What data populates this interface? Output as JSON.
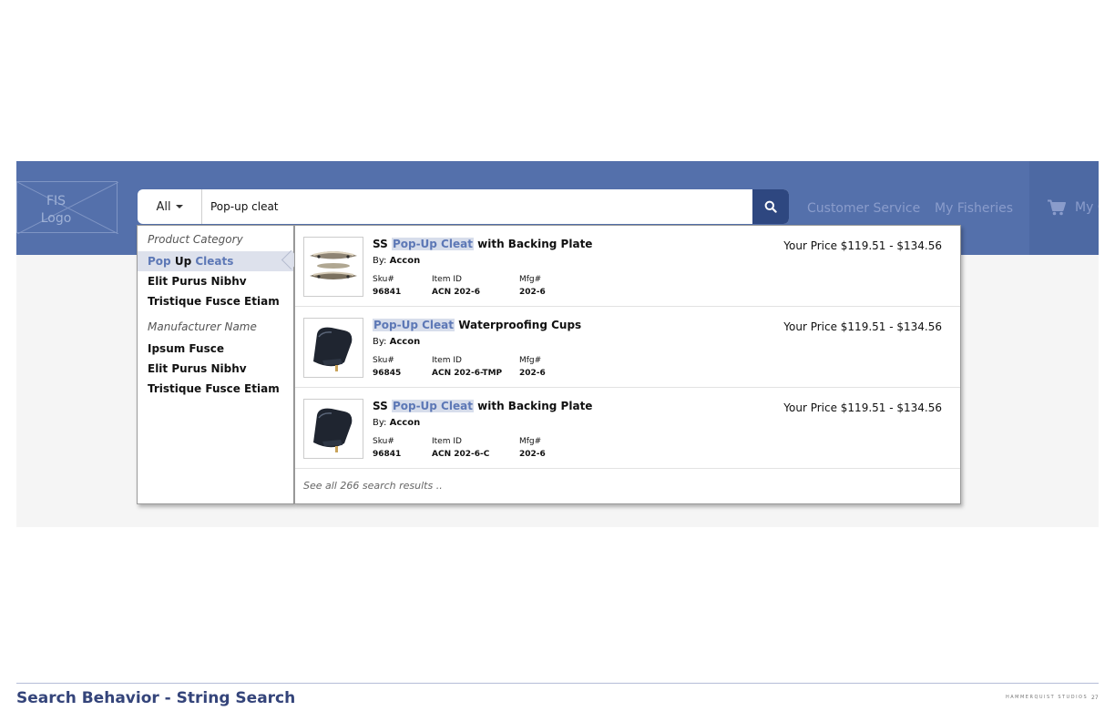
{
  "header": {
    "logo_text": "FIS\nLogo",
    "search": {
      "scope_label": "All",
      "query": "Pop-up cleat"
    },
    "nav": [
      "Customer Service",
      "My Fisheries"
    ],
    "account_label": "My C"
  },
  "suggestions": {
    "category_heading": "Product Category",
    "categories": [
      {
        "label": "Elit Purus Nibhv"
      },
      {
        "label": "Tristique Fusce Etiam"
      }
    ],
    "active_category": {
      "part1": "Pop",
      "part2": "Up",
      "part3": "Cleats"
    },
    "manufacturer_heading": "Manufacturer Name",
    "manufacturers": [
      {
        "label": "Ipsum Fusce"
      },
      {
        "label": "Elit Purus Nibhv"
      },
      {
        "label": "Tristique Fusce Etiam"
      }
    ]
  },
  "results": [
    {
      "name_prefix": "SS",
      "name_match": "Pop-Up Cleat",
      "name_suffix": "with Backing Plate",
      "by_label": "By:",
      "brand": "Accon",
      "sku_label": "Sku#",
      "sku": "96841",
      "item_label": "Item ID",
      "item_id": "ACN 202-6",
      "mfg_label": "Mfg#",
      "mfg": "202-6",
      "price": "Your Price $119.51 - $134.56"
    },
    {
      "name_prefix": "",
      "name_match": "Pop-Up Cleat",
      "name_suffix": "Waterproofing Cups",
      "by_label": "By:",
      "brand": "Accon",
      "sku_label": "Sku#",
      "sku": "96845",
      "item_label": "Item ID",
      "item_id": "ACN 202-6-TMP",
      "mfg_label": "Mfg#",
      "mfg": "202-6",
      "price": "Your Price $119.51 - $134.56"
    },
    {
      "name_prefix": "SS",
      "name_match": "Pop-Up Cleat",
      "name_suffix": "with Backing Plate",
      "by_label": "By:",
      "brand": "Accon",
      "sku_label": "Sku#",
      "sku": "96841",
      "item_label": "Item ID",
      "item_id": "ACN 202-6-C",
      "mfg_label": "Mfg#",
      "mfg": "202-6",
      "price": "Your Price $119.51 - $134.56"
    }
  ],
  "see_all": "See all 266 search results ..",
  "footer": {
    "title": "Search Behavior - String Search",
    "brand": "HAMMERQUIST STUDIOS",
    "page": "27"
  },
  "colors": {
    "header_bg": "#5470ab",
    "search_button": "#2e4780",
    "highlight": "#5d78b6",
    "active_row": "#dde1ec",
    "footer_title": "#34447a"
  },
  "icons": [
    "search-icon",
    "cart-icon",
    "caret-down-icon"
  ]
}
